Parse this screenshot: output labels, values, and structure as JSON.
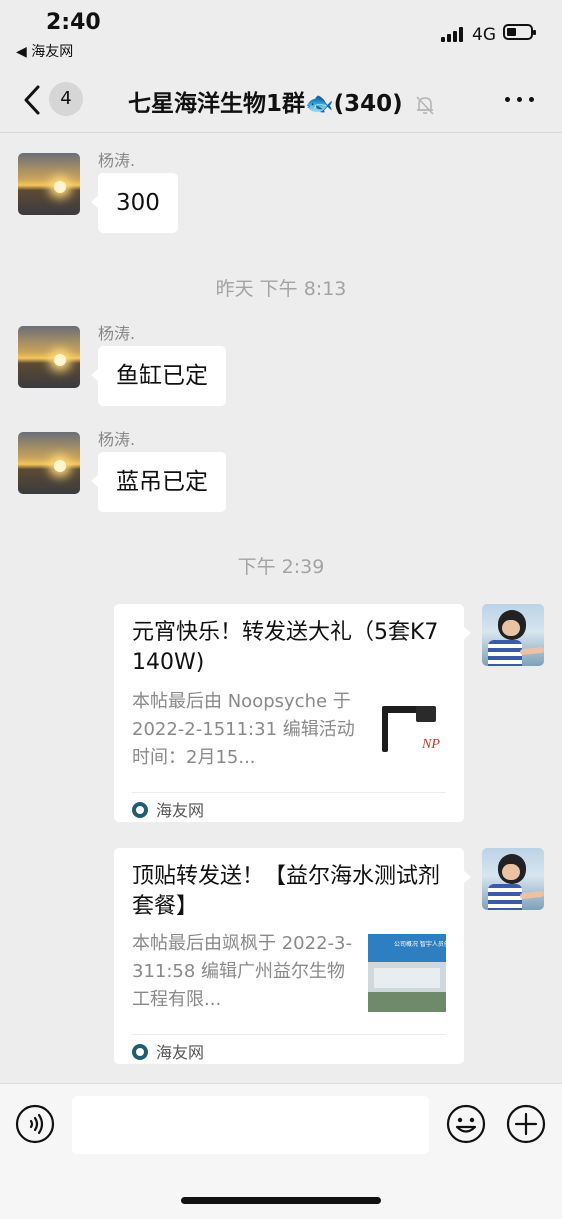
{
  "status_bar": {
    "time": "2:40",
    "back_app": "◀ 海友网",
    "network": "4G"
  },
  "nav": {
    "unread_badge": "4",
    "title": "七星海洋生物1群",
    "title_emoji": "🐟",
    "member_count": "(340)"
  },
  "messages": [
    {
      "sender": "杨涛.",
      "text": "300"
    },
    {
      "sender": "杨涛.",
      "text": "鱼缸已定"
    },
    {
      "sender": "杨涛.",
      "text": "蓝吊已定"
    }
  ],
  "timestamps": [
    "昨天 下午 8:13",
    "下午 2:39"
  ],
  "cards": [
    {
      "title": "元宵快乐！转发送大礼（5套K7 140W)",
      "desc": "本帖最后由 Noopsyche 于 2022-2-1511:31 编辑活动时间：2月15...",
      "source": "海友网",
      "thumb_label": "NP"
    },
    {
      "title": "顶贴转发送！【益尔海水测试剂套餐】",
      "desc": "本帖最后由飒枫于 2022-3-311:58 编辑广州益尔生物工程有限...",
      "source": "海友网",
      "thumb_label": "公司概况 智宇人员创业园"
    }
  ]
}
